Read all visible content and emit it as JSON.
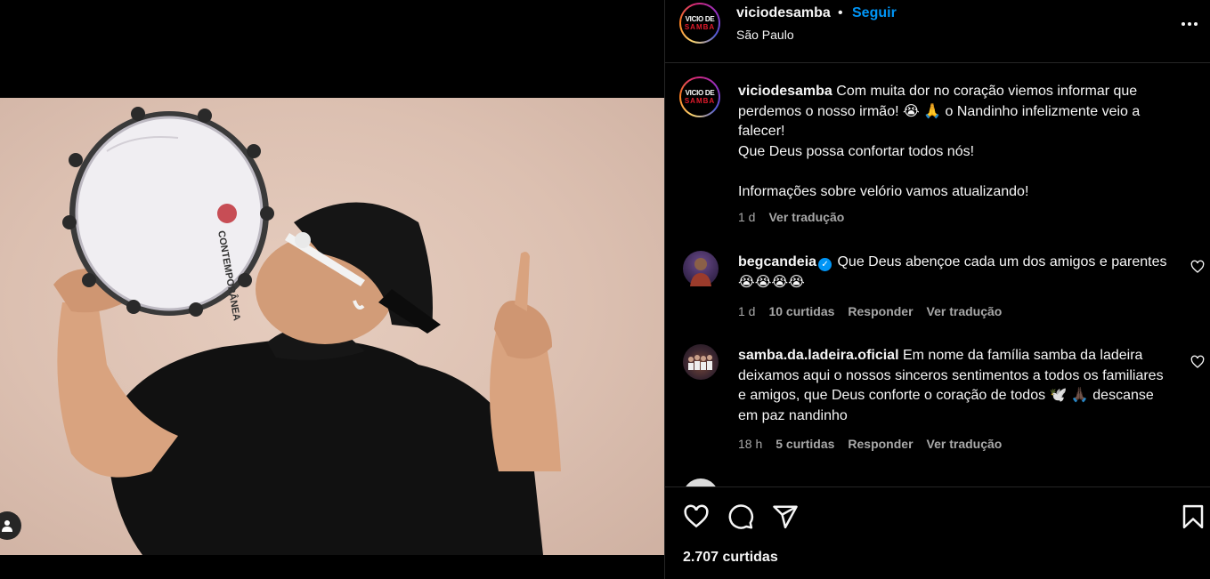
{
  "media": {
    "tag_icon": "person-icon"
  },
  "post": {
    "username": "viciodesamba",
    "separator": "•",
    "follow_label": "Seguir",
    "location": "São Paulo",
    "logo_top": "VICIO DE",
    "logo_bottom": "SAMBA",
    "more_icon": "more-horizontal-icon"
  },
  "caption": {
    "username": "viciodesamba",
    "text_1": " Com muita dor no coração viemos informar que perdemos o nosso irmão! 😭 🙏  o Nandinho infelizmente veio a falecer!",
    "text_2": "Que Deus possa confortar todos nós!",
    "text_3": "Informações sobre velório vamos atualizando!",
    "time": "1 d",
    "translate": "Ver tradução"
  },
  "comments": [
    {
      "username": "begcandeia",
      "verified": true,
      "text": " Que Deus abençoe cada um dos amigos e parentes 😭😭😭😭",
      "time": "1 d",
      "likes": "10 curtidas",
      "reply": "Responder",
      "translate": "Ver tradução"
    },
    {
      "username": "samba.da.ladeira.oficial",
      "verified": false,
      "text": " Em nome da família samba da ladeira deixamos aqui o nossos sinceros sentimentos a todos os familiares e amigos, que Deus conforte o coração de todos 🕊️ 🙏🏿 descanse em paz nandinho",
      "time": "18 h",
      "likes": "5 curtidas",
      "reply": "Responder",
      "translate": "Ver tradução"
    }
  ],
  "actions": {
    "like_icon": "heart-icon",
    "comment_icon": "comment-icon",
    "share_icon": "send-icon",
    "save_icon": "bookmark-icon"
  },
  "likes_count": "2.707 curtidas",
  "colors": {
    "background": "#000000",
    "text": "#f5f5f5",
    "secondary": "#a8a8a8",
    "link": "#0095f6",
    "border": "#262626"
  }
}
